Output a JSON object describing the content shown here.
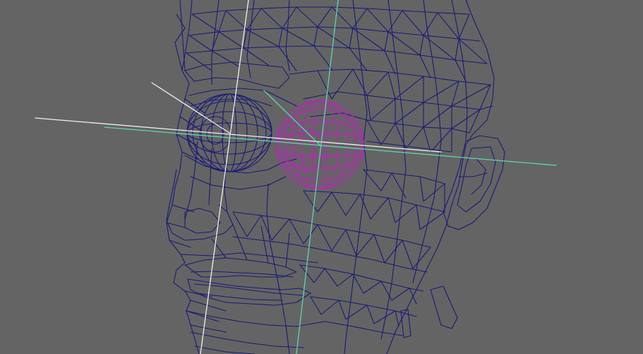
{
  "viewport": {
    "background_color": "#646464",
    "view": "3d-perspective-wireframe"
  },
  "scene": {
    "head_mesh": {
      "wire_color": "#1a1a78",
      "display_mode": "wireframe"
    },
    "left_eye": {
      "wire_color": "#1a1a78",
      "selected": false
    },
    "right_eye": {
      "wire_color": "#c020c0",
      "selected": true
    },
    "pivot_axes": {
      "primary_color": "#f0f0f0",
      "secondary_color": "#5ad8b0"
    }
  }
}
